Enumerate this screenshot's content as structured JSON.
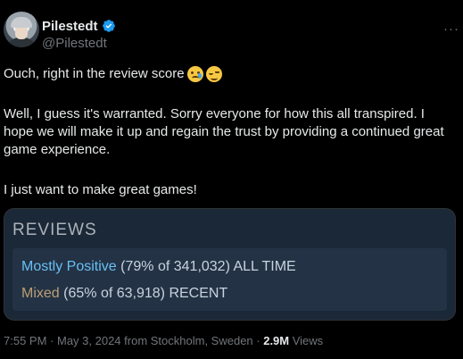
{
  "author": {
    "display_name": "Pilestedt",
    "handle": "@Pilestedt",
    "verified": true
  },
  "tweet": {
    "line1": "Ouch, right in the review score",
    "emojis": [
      "crying-face",
      "relieved-face"
    ],
    "paragraph2": "Well, I guess it's warranted. Sorry everyone for how this all transpired. I hope we will make it up and regain the trust by providing a continued great game experience.",
    "paragraph3": "I just want to make great games!"
  },
  "reviews_card": {
    "title": "REVIEWS",
    "all_time": {
      "rating": "Mostly Positive",
      "detail": "(79% of 341,032) ALL TIME",
      "color": "#66c0f4"
    },
    "recent": {
      "rating": "Mixed",
      "detail": "(65% of 63,918) RECENT",
      "color": "#b9a074"
    }
  },
  "meta": {
    "time": "7:55 PM",
    "separator": " · ",
    "date": "May 3, 2024",
    "location": " from Stockholm, Sweden",
    "views_count": "2.9M",
    "views_label": " Views"
  },
  "colors": {
    "background": "#000000",
    "text": "#e7e9ea",
    "muted": "#71767b",
    "verified": "#1d9bf0",
    "card_bg": "#1b2838"
  }
}
